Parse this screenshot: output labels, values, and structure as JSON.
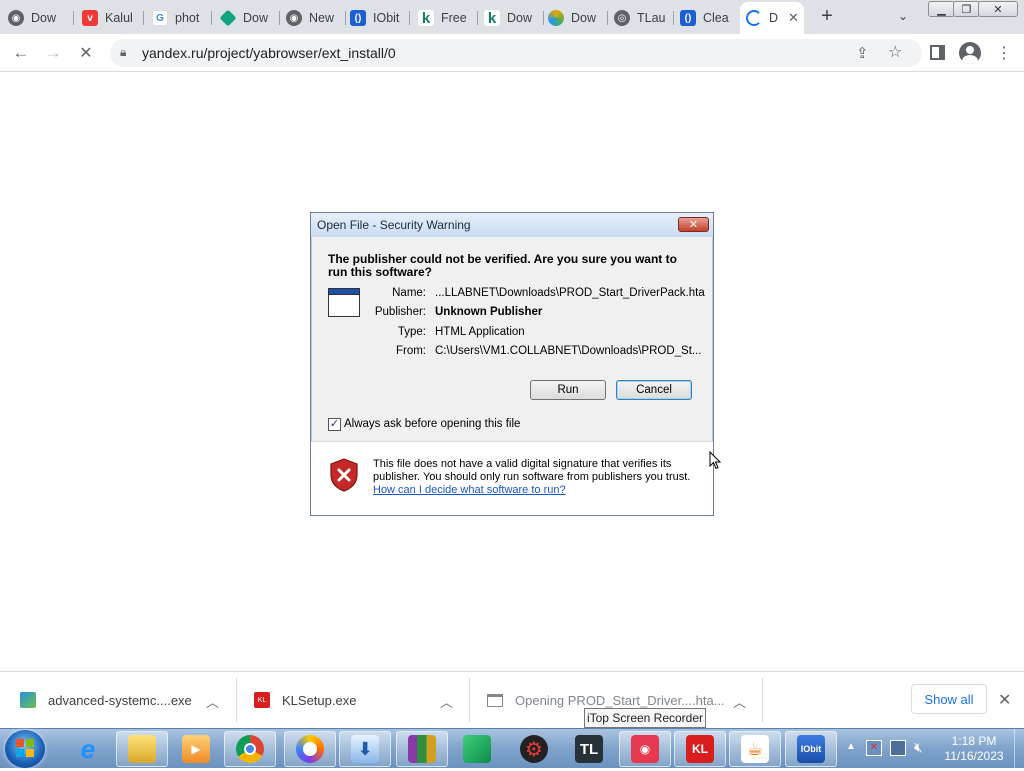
{
  "browser": {
    "tabs": [
      {
        "label": "Dow",
        "icon": "chrome-icon",
        "color": "#5f6368"
      },
      {
        "label": "Kalul",
        "icon": "vivaldi-icon",
        "color": "#ef3939"
      },
      {
        "label": "phot",
        "icon": "google-icon",
        "color": "#4285f4"
      },
      {
        "label": "Dow",
        "icon": "diamond-icon",
        "color": "#12a37f"
      },
      {
        "label": "New",
        "icon": "chrome-icon",
        "color": "#5f6368"
      },
      {
        "label": "IObit",
        "icon": "iobit-icon",
        "color": "#1a5fd6"
      },
      {
        "label": "Free",
        "icon": "k-icon",
        "color": "#0f7f5f"
      },
      {
        "label": "Dow",
        "icon": "k-icon",
        "color": "#0f7f5f"
      },
      {
        "label": "Dow",
        "icon": "colorful-icon",
        "color": "#e8a800"
      },
      {
        "label": "TLau",
        "icon": "globe-icon",
        "color": "#5f6368"
      },
      {
        "label": "Clea",
        "icon": "iobit-icon",
        "color": "#1a5fd6"
      },
      {
        "label": "D",
        "icon": "loading-icon",
        "color": "#1a73e8"
      }
    ],
    "new_tab_symbol": "+",
    "url": "yandex.ru/project/yabrowser/ext_install/0"
  },
  "dialog": {
    "title": "Open File - Security Warning",
    "heading": "The publisher could not be verified.  Are you sure you want to run this software?",
    "fields": [
      {
        "label": "Name:",
        "value": "...LLABNET\\Downloads\\PROD_Start_DriverPack.hta"
      },
      {
        "label": "Publisher:",
        "value": "Unknown Publisher"
      },
      {
        "label": "Type:",
        "value": "HTML Application"
      },
      {
        "label": "From:",
        "value": "C:\\Users\\VM1.COLLABNET\\Downloads\\PROD_St..."
      }
    ],
    "run_label": "Run",
    "cancel_label": "Cancel",
    "checkbox_label": "Always ask before opening this file",
    "checkbox_checked": true,
    "warning_text": "This file does not have a valid digital signature that verifies its publisher.  You should only run software from publishers you trust.",
    "help_link": "How can I decide what software to run?"
  },
  "downloads": {
    "items": [
      {
        "name": "advanced-systemc....exe",
        "icon": "installer-icon"
      },
      {
        "name": "KLSetup.exe",
        "icon": "kaspersky-icon"
      },
      {
        "name": "Opening PROD_Start_Driver....hta...",
        "icon": "file-icon"
      }
    ],
    "show_all_label": "Show all",
    "tooltip": "iTop Screen Recorder"
  },
  "taskbar": {
    "time": "1:18 PM",
    "date": "11/16/2023",
    "apps": [
      "ie-icon",
      "explorer-icon",
      "media-player-icon",
      "chrome-icon",
      "yandex-icon",
      "downloader-icon",
      "winrar-icon",
      "box-icon",
      "gear-app-icon",
      "tl-icon",
      "screen-recorder-icon",
      "kl-icon",
      "java-icon",
      "iobit-installer-icon"
    ],
    "tl_label": "TL",
    "kl_label": "KL"
  }
}
